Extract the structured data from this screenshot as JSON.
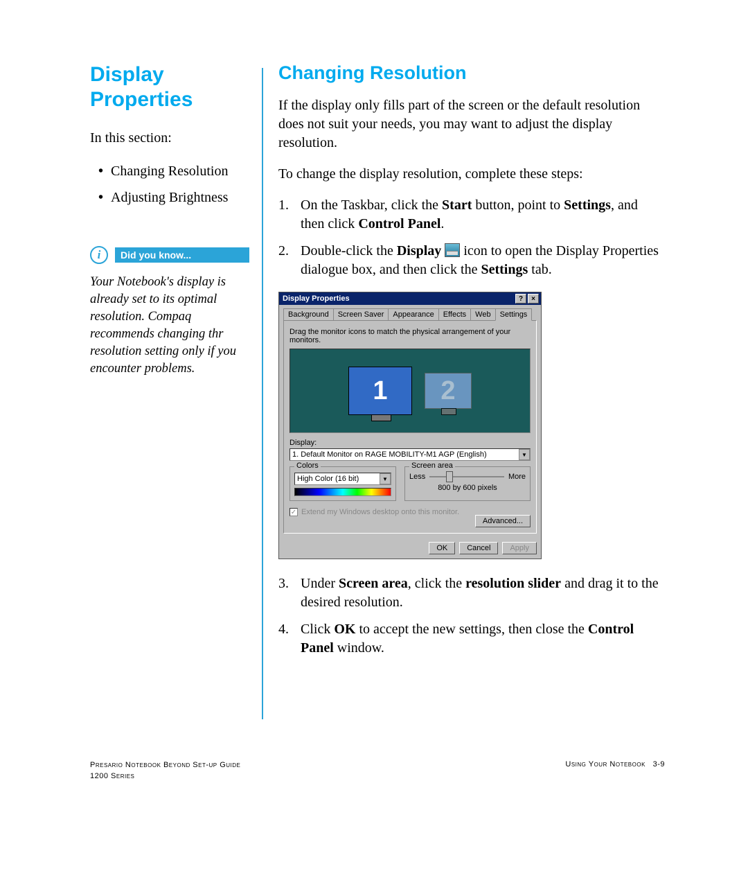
{
  "left": {
    "title": "Display Properties",
    "in_this_section": "In this section:",
    "toc": [
      "Changing Resolution",
      "Adjusting Brightness"
    ],
    "dyk_label": "Did you know...",
    "dyk_text": "Your Notebook's display is already set to its optimal resolution. Compaq recommends changing thr resolution setting only if you encounter problems."
  },
  "right": {
    "heading": "Changing Resolution",
    "intro": "If the display only fills part of the screen or the default resolution does not suit your needs, you may want to adjust the display resolution.",
    "lead": "To change the display resolution, complete these steps:",
    "step1_a": "On the Taskbar, click the ",
    "step1_b": " button, point to ",
    "step1_c": ", and then click ",
    "step1_d": ".",
    "bold_start": "Start",
    "bold_settings": "Settings",
    "bold_cp": "Control Panel",
    "step2_a": "Double-click the ",
    "step2_b": " icon to open the Display Properties dialogue box, and then click the ",
    "step2_c": " tab.",
    "bold_display": "Display",
    "bold_settings_tab": "Settings",
    "step3_a": "Under ",
    "step3_b": ", click the ",
    "step3_c": " and drag it to the desired resolution.",
    "bold_screen_area": "Screen area",
    "bold_res_slider": "resolution slider",
    "step4_a": "Click ",
    "step4_b": " to accept the new settings, then close the ",
    "step4_c": " window.",
    "bold_ok": "OK",
    "bold_cp2": "Control Panel"
  },
  "dialog": {
    "title": "Display Properties",
    "help": "?",
    "close": "×",
    "tabs": [
      "Background",
      "Screen Saver",
      "Appearance",
      "Effects",
      "Web",
      "Settings"
    ],
    "active_tab": 5,
    "instruction": "Drag the monitor icons to match the physical arrangement of your monitors.",
    "mon1": "1",
    "mon2": "2",
    "display_label": "Display:",
    "display_value": "1. Default Monitor on RAGE MOBILITY-M1 AGP (English)",
    "colors_group": "Colors",
    "colors_value": "High Color (16 bit)",
    "screen_area_group": "Screen area",
    "less": "Less",
    "more": "More",
    "resolution": "800 by 600 pixels",
    "extend": "Extend my Windows desktop onto this monitor.",
    "advanced": "Advanced...",
    "ok": "OK",
    "cancel": "Cancel",
    "apply": "Apply"
  },
  "footer": {
    "left1": "Presario Notebook Beyond Set-up Guide",
    "left2": "1200 Series",
    "right1": "Using Your Notebook",
    "page": "3-9"
  }
}
